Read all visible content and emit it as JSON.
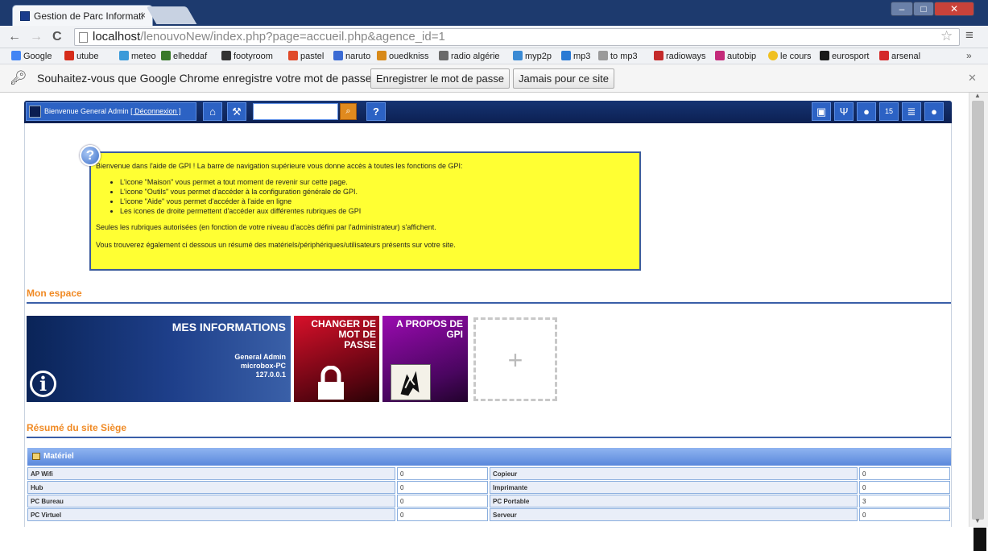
{
  "browser": {
    "tab_title": "Gestion de Parc Informati",
    "url_host": "localhost",
    "url_path": "/lenouvoNew/index.php?page=accueil.php&agence_id=1",
    "bookmarks": [
      {
        "label": "Google",
        "color": "#4285f4"
      },
      {
        "label": "utube",
        "color": "#d62c1a"
      },
      {
        "label": "meteo",
        "color": "#3a9ad9"
      },
      {
        "label": "elheddaf",
        "color": "#3a7a2a"
      },
      {
        "label": "footyroom",
        "color": "#333333"
      },
      {
        "label": "pastel",
        "color": "#e04a2a"
      },
      {
        "label": "naruto",
        "color": "#3a6ad4"
      },
      {
        "label": "ouedkniss",
        "color": "#d88a1a"
      },
      {
        "label": "radio algérie",
        "color": "#6a6a6a"
      },
      {
        "label": "myp2p",
        "color": "#3a8ad4"
      },
      {
        "label": "mp3",
        "color": "#2a7ad4"
      },
      {
        "label": "to mp3",
        "color": "#9a9a9a"
      },
      {
        "label": "radioways",
        "color": "#c42a2a"
      },
      {
        "label": "autobip",
        "color": "#c42a7a"
      },
      {
        "label": "le cours",
        "color": "#f0c020"
      },
      {
        "label": "eurosport",
        "color": "#1a1a1a"
      },
      {
        "label": "arsenal",
        "color": "#d42a2a"
      }
    ],
    "infobar": {
      "message": "Souhaitez-vous que Google Chrome enregistre votre mot de passe ?",
      "save_label": "Enregistrer le mot de passe",
      "never_label": "Jamais pour ce site"
    }
  },
  "gpi": {
    "welcome": "Bienvenue General Admin",
    "logout": "[ Déconnexion ]",
    "help_intro": "Bienvenue dans l'aide de GPI ! La barre de navigation supérieure vous donne accès à toutes les fonctions de GPI:",
    "help_items": [
      "L'icone \"Maison\" vous permet a tout moment de revenir sur cette page.",
      "L'icone \"Outils\" vous permet d'accéder à la configuration générale de GPI.",
      "L'icone \"Aide\" vous permet d'accéder à l'aide en ligne",
      "Les icones de droite permettent d'accéder aux différentes rubriques de GPI"
    ],
    "help_p2": "Seules les rubriques autorisées (en fonction de votre niveau d'accès défini par l'administrateur) s'affichent.",
    "help_p3": "Vous trouverez également ci dessous un résumé des matériels/périphériques/utilisateurs présents sur votre site.",
    "mon_espace": "Mon espace",
    "tiles": {
      "info_title": "MES INFORMATIONS",
      "info_user": "General Admin",
      "info_host": "microbox-PC",
      "info_ip": "127.0.0.1",
      "pwd_title_1": "CHANGER DE",
      "pwd_title_2": "MOT DE",
      "pwd_title_3": "PASSE",
      "about_title_1": "A PROPOS DE",
      "about_title_2": "GPI",
      "add_symbol": "+"
    },
    "resume_title": "Résumé du site Siège",
    "materiel_title": "Matériel",
    "materiel_rows": [
      {
        "l1": "AP Wifi",
        "v1": "0",
        "l2": "Copieur",
        "v2": "0"
      },
      {
        "l1": "Hub",
        "v1": "0",
        "l2": "Imprimante",
        "v2": "0"
      },
      {
        "l1": "PC Bureau",
        "v1": "0",
        "l2": "PC Portable",
        "v2": "3"
      },
      {
        "l1": "PC Virtuel",
        "v1": "0",
        "l2": "Serveur",
        "v2": "0"
      }
    ]
  }
}
